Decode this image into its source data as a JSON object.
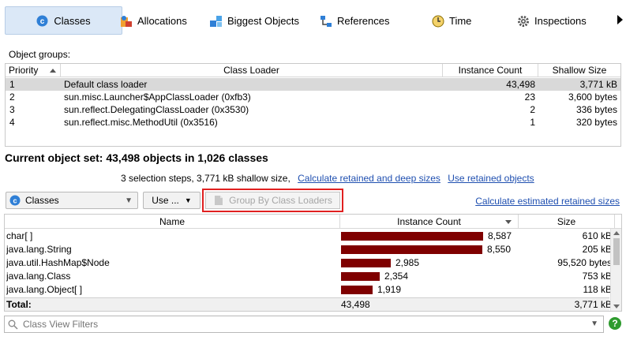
{
  "tabs": [
    {
      "label": "Classes",
      "icon": "classes-icon",
      "active": true
    },
    {
      "label": "Allocations",
      "icon": "allocations-icon"
    },
    {
      "label": "Biggest Objects",
      "icon": "biggest-objects-icon"
    },
    {
      "label": "References",
      "icon": "references-icon"
    },
    {
      "label": "Time",
      "icon": "time-icon"
    },
    {
      "label": "Inspections",
      "icon": "inspections-icon"
    }
  ],
  "object_groups": {
    "label": "Object groups:",
    "columns": [
      "Priority",
      "Class Loader",
      "Instance Count",
      "Shallow Size"
    ],
    "rows": [
      {
        "priority": "1",
        "loader": "Default class loader",
        "count": "43,498",
        "size": "3,771 kB",
        "selected": true
      },
      {
        "priority": "2",
        "loader": "sun.misc.Launcher$AppClassLoader (0xfb3)",
        "count": "23",
        "size": "3,600 bytes"
      },
      {
        "priority": "3",
        "loader": "sun.reflect.DelegatingClassLoader (0x3530)",
        "count": "2",
        "size": "336 bytes"
      },
      {
        "priority": "4",
        "loader": "sun.reflect.misc.MethodUtil (0x3516)",
        "count": "1",
        "size": "320 bytes"
      }
    ]
  },
  "current_set": {
    "title": "Current object set:  43,498 objects in 1,026 classes",
    "subtitle": "3 selection steps, 3,771 kB shallow size,",
    "link_retained_deep": "Calculate retained and deep sizes",
    "link_use_retained": "Use retained objects"
  },
  "toolbar": {
    "view_combo": "Classes",
    "use_button": "Use ...",
    "group_button": "Group By Class Loaders",
    "calc_estimated": "Calculate estimated retained sizes"
  },
  "classes_table": {
    "columns": [
      "Name",
      "Instance Count",
      "Size"
    ],
    "max_count": 8587,
    "rows": [
      {
        "name": "char[ ]",
        "count": 8587,
        "count_label": "8,587",
        "size": "610 kB"
      },
      {
        "name": "java.lang.String",
        "count": 8550,
        "count_label": "8,550",
        "size": "205 kB"
      },
      {
        "name": "java.util.HashMap$Node",
        "count": 2985,
        "count_label": "2,985",
        "size": "95,520 bytes"
      },
      {
        "name": "java.lang.Class",
        "count": 2354,
        "count_label": "2,354",
        "size": "753 kB"
      },
      {
        "name": "java.lang.Object[ ]",
        "count": 1919,
        "count_label": "1,919",
        "size": "118 kB"
      }
    ],
    "total_label": "Total:",
    "total_count": "43,498",
    "total_size": "3,771 kB"
  },
  "filter": {
    "placeholder": "Class View Filters"
  },
  "colors": {
    "bar": "#7f0000",
    "active_tab": "#dbe8f7",
    "highlight_border": "#e02020",
    "link": "#1f4fb0"
  }
}
